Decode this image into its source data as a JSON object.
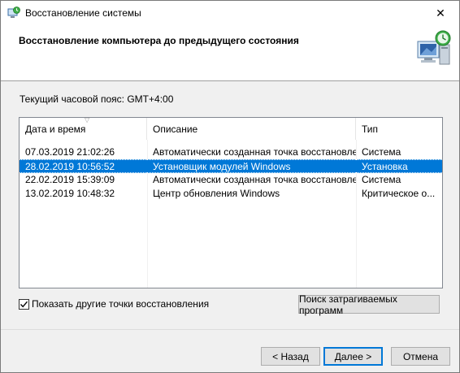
{
  "window": {
    "title": "Восстановление системы",
    "close_glyph": "✕"
  },
  "header": {
    "title": "Восстановление компьютера до предыдущего состояния"
  },
  "timezone": {
    "label": "Текущий часовой пояс: GMT+4:00"
  },
  "table": {
    "columns": [
      "Дата и время",
      "Описание",
      "Тип"
    ],
    "sort_indicator": "▽",
    "rows": [
      {
        "date": "07.03.2019 21:02:26",
        "description": "Автоматически созданная точка восстановле...",
        "type": "Система",
        "selected": false
      },
      {
        "date": "28.02.2019 10:56:52",
        "description": "Установщик модулей Windows",
        "type": "Установка",
        "selected": true
      },
      {
        "date": "22.02.2019 15:39:09",
        "description": "Автоматически созданная точка восстановле...",
        "type": "Система",
        "selected": false
      },
      {
        "date": "13.02.2019 10:48:32",
        "description": "Центр обновления Windows",
        "type": "Критическое о...",
        "selected": false
      }
    ]
  },
  "show_more": {
    "label": "Показать другие точки восстановления",
    "checked": true
  },
  "buttons": {
    "scan": "Поиск затрагиваемых программ",
    "back": "< Назад",
    "next": "Далее >",
    "cancel": "Отмена"
  },
  "colors": {
    "selection": "#0078d7",
    "panel": "#f0f0f0"
  }
}
